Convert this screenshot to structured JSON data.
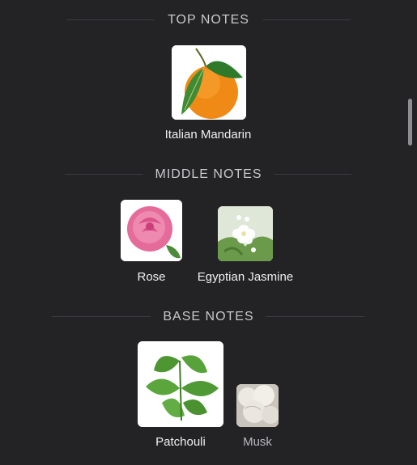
{
  "sections": {
    "top": {
      "title": "TOP NOTES"
    },
    "middle": {
      "title": "MIDDLE NOTES"
    },
    "base": {
      "title": "BASE NOTES"
    }
  },
  "notes": {
    "mandarin": {
      "label": "Italian Mandarin",
      "icon": "mandarin-image"
    },
    "rose": {
      "label": "Rose",
      "icon": "rose-image"
    },
    "jasmine": {
      "label": "Egyptian Jasmine",
      "icon": "jasmine-image"
    },
    "patchouli": {
      "label": "Patchouli",
      "icon": "patchouli-image"
    },
    "musk": {
      "label": "Musk",
      "icon": "musk-image"
    }
  },
  "colors": {
    "background": "#232326",
    "text": "#e9e9ea",
    "section_title": "#c9c9cc",
    "divider": "#3c3c40"
  }
}
